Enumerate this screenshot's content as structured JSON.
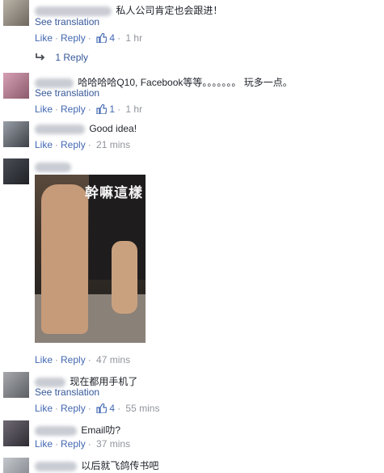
{
  "ui": {
    "like_label": "Like",
    "reply_label": "Reply",
    "see_translation": "See translation"
  },
  "comments": [
    {
      "body": "私人公司肯定也会跟进！",
      "likes": "4",
      "time": "1 hr",
      "replies": "1 Reply"
    },
    {
      "body": "哈哈哈哈Q10, Facebook等等。。。。。。。 玩多一点。",
      "likes": "1",
      "time": "1 hr"
    },
    {
      "body": "Good idea!",
      "time": "21 mins"
    },
    {
      "photo_caption": "幹嘛這樣",
      "time": "47 mins"
    },
    {
      "body": "现在都用手机了",
      "likes": "4",
      "time": "55 mins"
    },
    {
      "body": "Email叻?",
      "time": "37 mins"
    },
    {
      "body": "以后就飞鸽传书吧"
    }
  ],
  "colors": {
    "link": "#4267b2",
    "translation": "#365899",
    "meta": "#90949c",
    "text": "#1d2129"
  }
}
